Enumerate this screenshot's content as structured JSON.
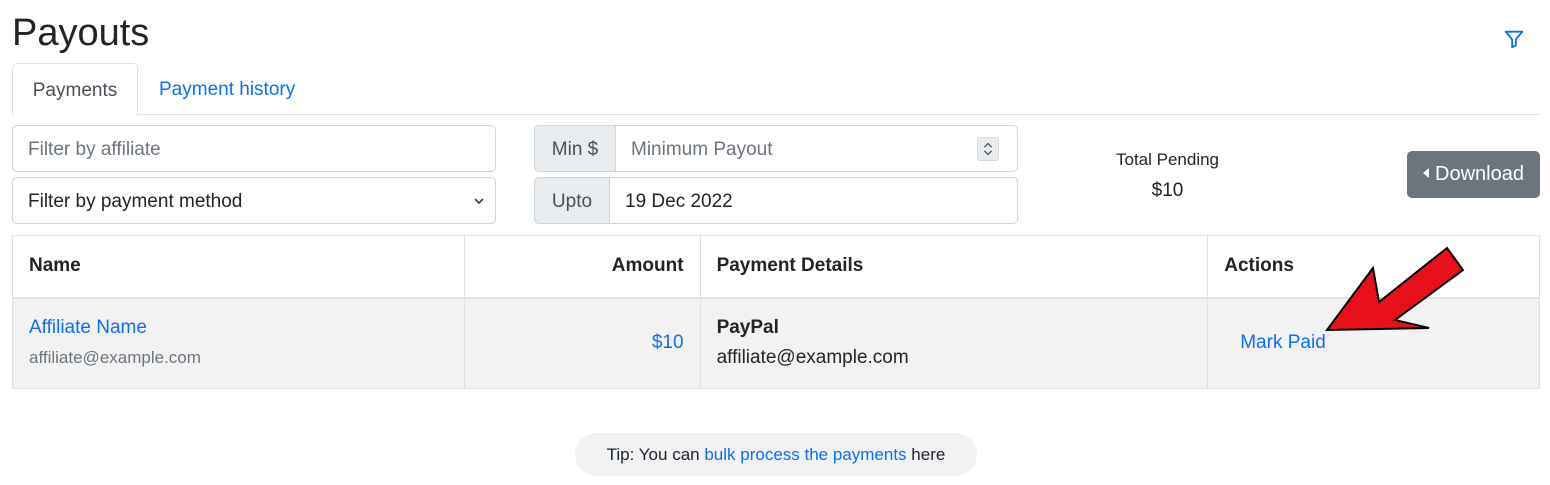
{
  "page": {
    "title": "Payouts"
  },
  "tabs": [
    {
      "label": "Payments",
      "active": true
    },
    {
      "label": "Payment history",
      "active": false
    }
  ],
  "filters": {
    "affiliate_placeholder": "Filter by affiliate",
    "payment_method_selected": "Filter by payment method",
    "min_label": "Min $",
    "min_placeholder": "Minimum Payout",
    "upto_label": "Upto",
    "upto_value": "19 Dec 2022"
  },
  "summary": {
    "total_label": "Total Pending",
    "total_value": "$10"
  },
  "download_label": "Download",
  "table": {
    "headers": {
      "name": "Name",
      "amount": "Amount",
      "details": "Payment Details",
      "actions": "Actions"
    },
    "rows": [
      {
        "name": "Affiliate Name",
        "email": "affiliate@example.com",
        "amount": "$10",
        "method": "PayPal",
        "method_detail": "affiliate@example.com",
        "action": "Mark Paid"
      }
    ]
  },
  "tip": {
    "prefix": "Tip: You can",
    "link": "bulk process the payments",
    "suffix": "here"
  },
  "colors": {
    "accent": "#0d6efd",
    "secondary_button": "#6c757d",
    "annotation_arrow": "#e8111b"
  },
  "icons": {
    "filter": "funnel-icon",
    "download": "caret-left-icon",
    "select": "chevron-down-icon",
    "number": "spinner-icon"
  }
}
